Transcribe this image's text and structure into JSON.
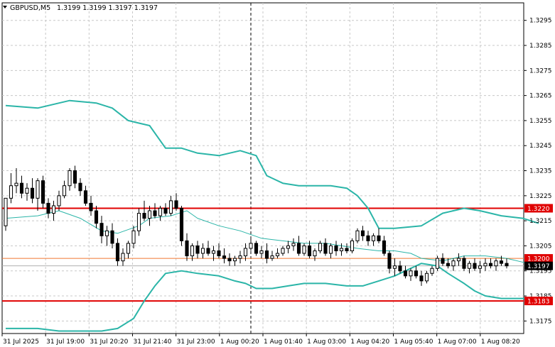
{
  "header": {
    "symbol": "GBPUSD,M5",
    "ohlc": "1.3199 1.3199 1.3197 1.3197"
  },
  "colors": {
    "background": "#ffffff",
    "grid": "#c8c8c8",
    "candle": "#000000",
    "bands": "#2bb5a8",
    "level_strong": "#e00000",
    "level_thin": "#f07830",
    "bid_label_bg": "#000000",
    "level_label_bg": "#e00000"
  },
  "price_axis": {
    "ticks": [
      "1.3295",
      "1.3285",
      "1.3275",
      "1.3265",
      "1.3255",
      "1.3245",
      "1.3235",
      "1.3225",
      "1.3215",
      "1.3205",
      "1.3195",
      "1.3185",
      "1.3175"
    ],
    "labels": [
      {
        "text": "1.3220",
        "kind": "level"
      },
      {
        "text": "1.3200",
        "kind": "level"
      },
      {
        "text": "1.3197",
        "kind": "bid"
      },
      {
        "text": "1.3183",
        "kind": "level"
      }
    ]
  },
  "time_axis": {
    "ticks": [
      "31 Jul 2025",
      "31 Jul 19:00",
      "31 Jul 20:20",
      "31 Jul 21:40",
      "31 Jul 23:00",
      "1 Aug 00:20",
      "1 Aug 01:40",
      "1 Aug 03:00",
      "1 Aug 04:20",
      "1 Aug 05:40",
      "1 Aug 07:00",
      "1 Aug 08:20"
    ]
  },
  "chart_data": {
    "type": "candlestick",
    "symbol": "GBPUSD",
    "timeframe": "M5",
    "ylim": [
      1.317,
      1.3302
    ],
    "levels": [
      {
        "price": 1.322,
        "style": "thick-red"
      },
      {
        "price": 1.32,
        "style": "thin-orange"
      },
      {
        "price": 1.3183,
        "style": "thick-red"
      }
    ],
    "bid": 1.3197,
    "period_separator_index": 46,
    "bands_upper_keypoints": [
      [
        0,
        1.3261
      ],
      [
        6,
        1.326
      ],
      [
        12,
        1.3263
      ],
      [
        17,
        1.3262
      ],
      [
        20,
        1.326
      ],
      [
        23,
        1.3255
      ],
      [
        25,
        1.3254
      ],
      [
        27,
        1.3253
      ],
      [
        30,
        1.3244
      ],
      [
        33,
        1.3244
      ],
      [
        36,
        1.3242
      ],
      [
        40,
        1.3241
      ],
      [
        44,
        1.3243
      ],
      [
        47,
        1.3241
      ],
      [
        49,
        1.3233
      ],
      [
        52,
        1.323
      ],
      [
        55,
        1.3229
      ],
      [
        61,
        1.3229
      ],
      [
        64,
        1.3228
      ],
      [
        66,
        1.3225
      ],
      [
        68,
        1.322
      ],
      [
        70,
        1.3212
      ],
      [
        73,
        1.3212
      ],
      [
        78,
        1.3213
      ],
      [
        82,
        1.3218
      ],
      [
        86,
        1.322
      ],
      [
        89,
        1.3219
      ],
      [
        93,
        1.3217
      ],
      [
        97,
        1.3216
      ],
      [
        100,
        1.3214
      ]
    ],
    "bands_middle_keypoints": [
      [
        0,
        1.3216
      ],
      [
        6,
        1.3217
      ],
      [
        10,
        1.3219
      ],
      [
        14,
        1.3216
      ],
      [
        18,
        1.3211
      ],
      [
        21,
        1.321
      ],
      [
        25,
        1.3213
      ],
      [
        27,
        1.3216
      ],
      [
        31,
        1.3217
      ],
      [
        34,
        1.3219
      ],
      [
        36,
        1.3216
      ],
      [
        40,
        1.3213
      ],
      [
        44,
        1.3211
      ],
      [
        48,
        1.3208
      ],
      [
        52,
        1.3207
      ],
      [
        56,
        1.3206
      ],
      [
        60,
        1.3206
      ],
      [
        63,
        1.3205
      ],
      [
        66,
        1.3204
      ],
      [
        70,
        1.3203
      ],
      [
        73,
        1.3203
      ],
      [
        76,
        1.3202
      ],
      [
        78,
        1.32
      ],
      [
        82,
        1.3199
      ],
      [
        86,
        1.3201
      ],
      [
        90,
        1.3201
      ],
      [
        94,
        1.32
      ],
      [
        98,
        1.3198
      ]
    ],
    "bands_lower_keypoints": [
      [
        0,
        1.3172
      ],
      [
        6,
        1.3172
      ],
      [
        10,
        1.3171
      ],
      [
        14,
        1.3171
      ],
      [
        18,
        1.3171
      ],
      [
        21,
        1.3172
      ],
      [
        24,
        1.3176
      ],
      [
        26,
        1.3183
      ],
      [
        28,
        1.3189
      ],
      [
        30,
        1.3194
      ],
      [
        33,
        1.3195
      ],
      [
        36,
        1.3194
      ],
      [
        40,
        1.3193
      ],
      [
        43,
        1.3191
      ],
      [
        45,
        1.319
      ],
      [
        47,
        1.3188
      ],
      [
        50,
        1.3188
      ],
      [
        53,
        1.3189
      ],
      [
        56,
        1.319
      ],
      [
        60,
        1.319
      ],
      [
        64,
        1.3189
      ],
      [
        67,
        1.3189
      ],
      [
        70,
        1.3191
      ],
      [
        73,
        1.3193
      ],
      [
        76,
        1.3196
      ],
      [
        78,
        1.3198
      ],
      [
        81,
        1.3197
      ],
      [
        83,
        1.3194
      ],
      [
        86,
        1.319
      ],
      [
        88,
        1.3187
      ],
      [
        90,
        1.3185
      ],
      [
        93,
        1.3184
      ],
      [
        97,
        1.3184
      ],
      [
        100,
        1.3183
      ]
    ],
    "candles": [
      [
        1.3213,
        1.3224,
        1.3211,
        1.3224
      ],
      [
        1.3224,
        1.3234,
        1.3222,
        1.3229
      ],
      [
        1.3229,
        1.3236,
        1.3226,
        1.323
      ],
      [
        1.323,
        1.3233,
        1.3224,
        1.3226
      ],
      [
        1.3226,
        1.323,
        1.3223,
        1.3228
      ],
      [
        1.3228,
        1.3232,
        1.3222,
        1.3224
      ],
      [
        1.3224,
        1.3232,
        1.3219,
        1.3231
      ],
      [
        1.3231,
        1.3233,
        1.322,
        1.3222
      ],
      [
        1.3222,
        1.3224,
        1.3216,
        1.3218
      ],
      [
        1.3218,
        1.3223,
        1.3215,
        1.3221
      ],
      [
        1.3221,
        1.3227,
        1.3219,
        1.3225
      ],
      [
        1.3225,
        1.3231,
        1.3224,
        1.3229
      ],
      [
        1.3229,
        1.3236,
        1.3227,
        1.3235
      ],
      [
        1.3235,
        1.3237,
        1.3228,
        1.323
      ],
      [
        1.323,
        1.3232,
        1.3225,
        1.3227
      ],
      [
        1.3227,
        1.3229,
        1.3221,
        1.3222
      ],
      [
        1.3222,
        1.3225,
        1.3217,
        1.3219
      ],
      [
        1.3219,
        1.3221,
        1.3212,
        1.3214
      ],
      [
        1.3214,
        1.3217,
        1.3206,
        1.3209
      ],
      [
        1.3209,
        1.3213,
        1.3205,
        1.3211
      ],
      [
        1.3211,
        1.3214,
        1.3204,
        1.3206
      ],
      [
        1.3206,
        1.3208,
        1.3197,
        1.3199
      ],
      [
        1.3199,
        1.3204,
        1.3197,
        1.3202
      ],
      [
        1.3202,
        1.3207,
        1.32,
        1.3206
      ],
      [
        1.3206,
        1.3213,
        1.3204,
        1.3211
      ],
      [
        1.3211,
        1.322,
        1.3209,
        1.3218
      ],
      [
        1.3218,
        1.3223,
        1.3215,
        1.3216
      ],
      [
        1.3216,
        1.3221,
        1.3213,
        1.3219
      ],
      [
        1.3219,
        1.3222,
        1.3216,
        1.3217
      ],
      [
        1.3217,
        1.3221,
        1.3215,
        1.322
      ],
      [
        1.322,
        1.3222,
        1.3217,
        1.3218
      ],
      [
        1.3218,
        1.3225,
        1.3217,
        1.3223
      ],
      [
        1.3223,
        1.3226,
        1.3219,
        1.322
      ],
      [
        1.322,
        1.3221,
        1.3205,
        1.3207
      ],
      [
        1.3207,
        1.321,
        1.3199,
        1.3201
      ],
      [
        1.3201,
        1.3206,
        1.3199,
        1.3205
      ],
      [
        1.3205,
        1.3207,
        1.32,
        1.3202
      ],
      [
        1.3202,
        1.3206,
        1.32,
        1.3204
      ],
      [
        1.3204,
        1.3207,
        1.3201,
        1.3202
      ],
      [
        1.3202,
        1.3205,
        1.3199,
        1.3203
      ],
      [
        1.3203,
        1.3206,
        1.32,
        1.3201
      ],
      [
        1.3201,
        1.3204,
        1.3198,
        1.32
      ],
      [
        1.32,
        1.3202,
        1.3197,
        1.3199
      ],
      [
        1.3199,
        1.3201,
        1.3197,
        1.32
      ],
      [
        1.32,
        1.3203,
        1.3198,
        1.3201
      ],
      [
        1.3201,
        1.3206,
        1.3199,
        1.3204
      ],
      [
        1.3204,
        1.3208,
        1.3203,
        1.3206
      ],
      [
        1.3206,
        1.3207,
        1.3201,
        1.3202
      ],
      [
        1.3202,
        1.3205,
        1.32,
        1.3203
      ],
      [
        1.3203,
        1.3206,
        1.3198,
        1.32
      ],
      [
        1.32,
        1.3203,
        1.3199,
        1.3201
      ],
      [
        1.3201,
        1.3204,
        1.32,
        1.3202
      ],
      [
        1.3202,
        1.3205,
        1.3201,
        1.3204
      ],
      [
        1.3204,
        1.3207,
        1.3202,
        1.3205
      ],
      [
        1.3205,
        1.3208,
        1.3203,
        1.3206
      ],
      [
        1.3206,
        1.3209,
        1.3201,
        1.3202
      ],
      [
        1.3202,
        1.3206,
        1.3201,
        1.3205
      ],
      [
        1.3205,
        1.3207,
        1.32,
        1.3201
      ],
      [
        1.3201,
        1.3204,
        1.3199,
        1.3203
      ],
      [
        1.3203,
        1.3207,
        1.3202,
        1.3206
      ],
      [
        1.3206,
        1.3208,
        1.3201,
        1.3202
      ],
      [
        1.3202,
        1.3206,
        1.32,
        1.3205
      ],
      [
        1.3205,
        1.3207,
        1.3201,
        1.3203
      ],
      [
        1.3203,
        1.3206,
        1.3201,
        1.3204
      ],
      [
        1.3204,
        1.3206,
        1.3202,
        1.3203
      ],
      [
        1.3203,
        1.3208,
        1.3202,
        1.3207
      ],
      [
        1.3207,
        1.3212,
        1.3206,
        1.3211
      ],
      [
        1.3211,
        1.3213,
        1.3207,
        1.3209
      ],
      [
        1.3209,
        1.3211,
        1.3205,
        1.3207
      ],
      [
        1.3207,
        1.321,
        1.3205,
        1.3209
      ],
      [
        1.3209,
        1.3212,
        1.3206,
        1.3207
      ],
      [
        1.3207,
        1.3209,
        1.3201,
        1.3202
      ],
      [
        1.3202,
        1.3203,
        1.3194,
        1.3196
      ],
      [
        1.3196,
        1.32,
        1.3193,
        1.3197
      ],
      [
        1.3197,
        1.3199,
        1.3194,
        1.3195
      ],
      [
        1.3195,
        1.3197,
        1.3192,
        1.3193
      ],
      [
        1.3193,
        1.3196,
        1.3191,
        1.3195
      ],
      [
        1.3195,
        1.3197,
        1.3192,
        1.3193
      ],
      [
        1.3193,
        1.3195,
        1.3189,
        1.3191
      ],
      [
        1.3191,
        1.3195,
        1.319,
        1.3194
      ],
      [
        1.3194,
        1.3197,
        1.3193,
        1.3196
      ],
      [
        1.3196,
        1.3201,
        1.3195,
        1.32
      ],
      [
        1.32,
        1.3202,
        1.3197,
        1.3198
      ],
      [
        1.3198,
        1.32,
        1.3196,
        1.3197
      ],
      [
        1.3197,
        1.32,
        1.3195,
        1.3199
      ],
      [
        1.3199,
        1.3202,
        1.3197,
        1.32
      ],
      [
        1.32,
        1.3201,
        1.3195,
        1.3196
      ],
      [
        1.3196,
        1.3199,
        1.3194,
        1.3198
      ],
      [
        1.3198,
        1.32,
        1.3195,
        1.3196
      ],
      [
        1.3196,
        1.3199,
        1.3194,
        1.3197
      ],
      [
        1.3197,
        1.32,
        1.3195,
        1.3198
      ],
      [
        1.3198,
        1.32,
        1.3196,
        1.3197
      ],
      [
        1.3197,
        1.32,
        1.3195,
        1.3199
      ],
      [
        1.3199,
        1.3201,
        1.3197,
        1.3198
      ],
      [
        1.3198,
        1.32,
        1.3196,
        1.3197
      ]
    ]
  }
}
